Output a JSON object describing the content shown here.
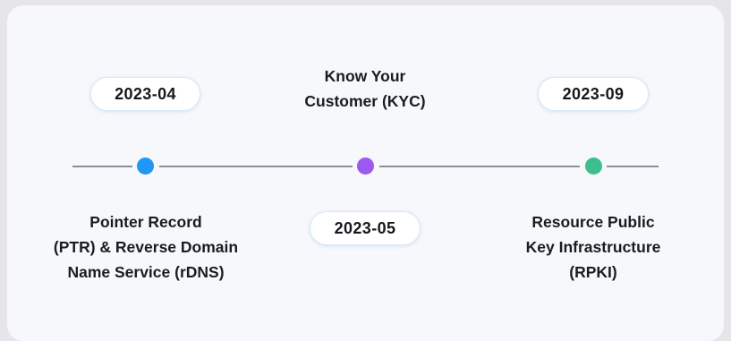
{
  "timeline": {
    "events": [
      {
        "date": "2023-04",
        "label_lines": [
          "Pointer Record",
          "(PTR) & Reverse Domain",
          "Name Service (rDNS)"
        ],
        "color": "#2196f3"
      },
      {
        "date": "2023-05",
        "label_lines": [
          "Know Your",
          "Customer (KYC)"
        ],
        "color": "#9b59f0"
      },
      {
        "date": "2023-09",
        "label_lines": [
          "Resource Public",
          "Key Infrastructure",
          "(RPKI)"
        ],
        "color": "#3cbf8c"
      }
    ]
  }
}
